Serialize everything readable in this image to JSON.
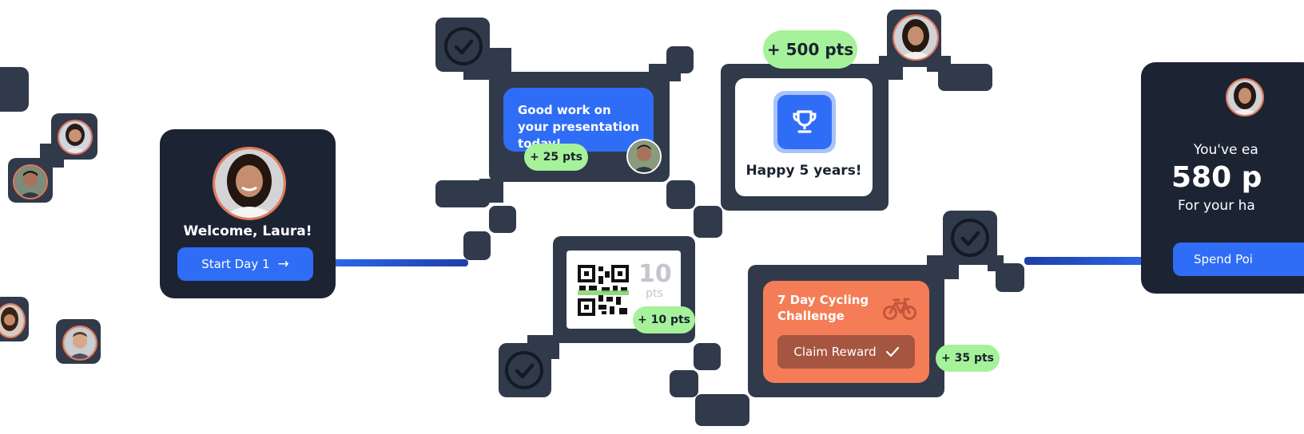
{
  "welcome": {
    "greeting": "Welcome, Laura!",
    "button": "Start Day 1",
    "arrow_icon": "arrow-right-icon"
  },
  "message": {
    "text": "Good work on your presentation today!",
    "pts": "+ 25 pts"
  },
  "milestone": {
    "pts": "+ 500 pts",
    "caption": "Happy 5 years!",
    "icon": "trophy-icon"
  },
  "qr": {
    "value": "10",
    "unit": "pts",
    "pts": "+ 10 pts"
  },
  "challenge": {
    "title": "7 Day Cycling Challenge",
    "button": "Claim Reward",
    "pts": "+ 35 pts",
    "icon": "bicycle-icon"
  },
  "earned": {
    "line1": "You've ea",
    "amount": "580 p",
    "line2": "For your ha",
    "button": "Spend Poi"
  },
  "colors": {
    "dark": "#1c2433",
    "connector": "#313a4a",
    "blue": "#2f6df6",
    "green": "#a6f29a",
    "orange": "#f47d57",
    "brown": "#a65540"
  }
}
